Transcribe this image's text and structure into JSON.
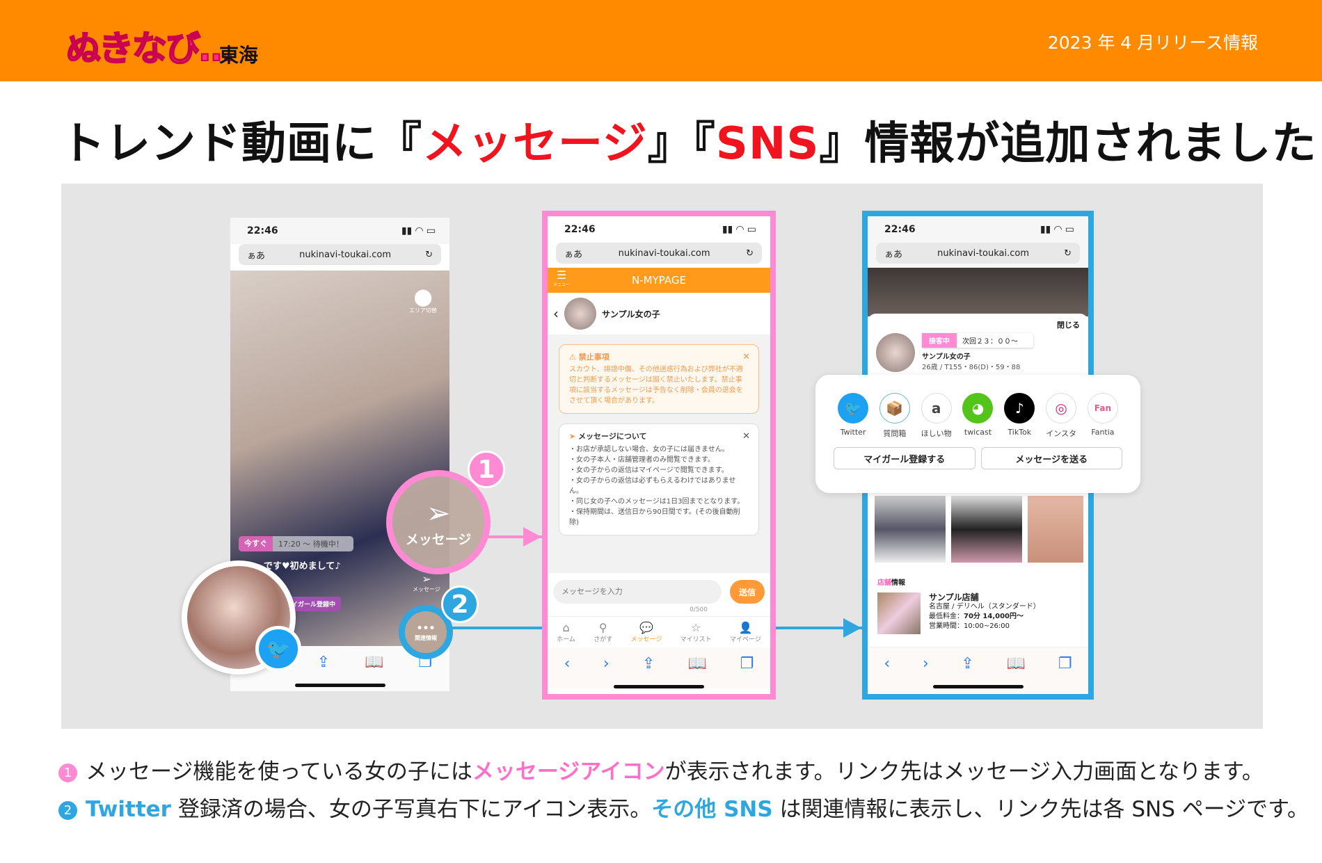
{
  "header": {
    "logo_text": "ぬきなび…",
    "logo_region": "東海",
    "release": "2023 年 4 月リリース情報"
  },
  "title": {
    "part1": "トレンド動画に『",
    "highlight1": "メッセージ",
    "part2": "』『",
    "highlight2": "SNS",
    "part3": "』情報が追加されました！"
  },
  "phone_common": {
    "time": "22:46",
    "aa": "ぁあ",
    "url": "nukinavi-toukai.com"
  },
  "left_phone": {
    "area_label": "エリア切替",
    "now_badge": "今すぐ",
    "wait_text": "17:20 ～ 待機中！",
    "comment": "です♥初めまして♪",
    "mygirl": "イガール登録中",
    "message_label": "メッセージ",
    "related_label": "関連情報"
  },
  "callout": {
    "message_circle": "メッセージ",
    "badge1": "1",
    "badge2": "2"
  },
  "middle_phone": {
    "menu": "メニュー",
    "brand": "N-MYPAGE",
    "girl_name": "サンプル女の子",
    "prohibited_title": "禁止事項",
    "prohibited_text": "スカウト、誹謗中傷、その他迷惑行為および弊社が不適切と判断するメッセージは固く禁止いたします。禁止事項に該当するメッセージは予告なく削除・会員の退会をさせて頂く場合があります。",
    "about_title": "メッセージについて",
    "about_items": [
      "・お店が承認しない場合、女の子には届きません。",
      "・女の子本人・店舗管理者のみ閲覧できます。",
      "・女の子からの返信はマイページで閲覧できます。",
      "・女の子からの返信は必ずもらえるわけではありません。",
      "・同じ女の子へのメッセージは1日3回までとなります。",
      "・保持期間は、送信日から90日間です。(その後自動削除)"
    ],
    "input_placeholder": "メッセージを入力",
    "send": "送信",
    "counter": "0/500",
    "nav": [
      {
        "icon": "home-icon",
        "label": "ホーム"
      },
      {
        "icon": "search-icon",
        "label": "さがす"
      },
      {
        "icon": "message-icon",
        "label": "メッセージ"
      },
      {
        "icon": "star-icon",
        "label": "マイリスト"
      },
      {
        "icon": "person-icon",
        "label": "マイページ"
      }
    ]
  },
  "right_phone": {
    "close": "閉じる",
    "status_badge": "接客中",
    "next": "次回２３：００～",
    "girl_name": "サンプル女の子",
    "profile": "26歳 / T155・86(D)・59・88",
    "sns": [
      {
        "icon": "twitter-icon",
        "label": "Twitter",
        "color": "#1da1f2"
      },
      {
        "icon": "question-box-icon",
        "label": "質問箱",
        "color": "#f5c26b"
      },
      {
        "icon": "amazon-icon",
        "label": "ほしい物",
        "color": "#222222"
      },
      {
        "icon": "twicast-icon",
        "label": "twicast",
        "color": "#52c41a"
      },
      {
        "icon": "tiktok-icon",
        "label": "TikTok",
        "color": "#000000"
      },
      {
        "icon": "instagram-icon",
        "label": "インスタ",
        "color": "#d62976"
      },
      {
        "icon": "fantia-icon",
        "label": "Fantia",
        "color": "#e05a8a"
      }
    ],
    "mygirl_button": "マイガール登録する",
    "message_button": "メッセージを送る",
    "shop_heading_a": "店舗",
    "shop_heading_b": "情報",
    "shop_name": "サンプル店舗",
    "shop_type": "名古屋 / デリヘル（スタンダード）",
    "price_label": "最低料金：",
    "price": "70分 14,000円～",
    "hours": "営業時間：10:00~26:00"
  },
  "footer": {
    "line1": {
      "num": "1",
      "a": "メッセージ機能を使っている女の子には",
      "hl": "メッセージアイコン",
      "b": "が表示されます。リンク先はメッセージ入力画面となります。"
    },
    "line2": {
      "num": "2",
      "hl1": "Twitter",
      "a": " 登録済の場合、女の子写真右下にアイコン表示。",
      "hl2": "その他 SNS",
      "b": " は関連情報に表示し、リンク先は各 SNS ページです。"
    }
  },
  "colors": {
    "orange": "#ff8a00",
    "pink": "#ff8ad4",
    "blue": "#2ea7e0",
    "red": "#f0141e"
  }
}
